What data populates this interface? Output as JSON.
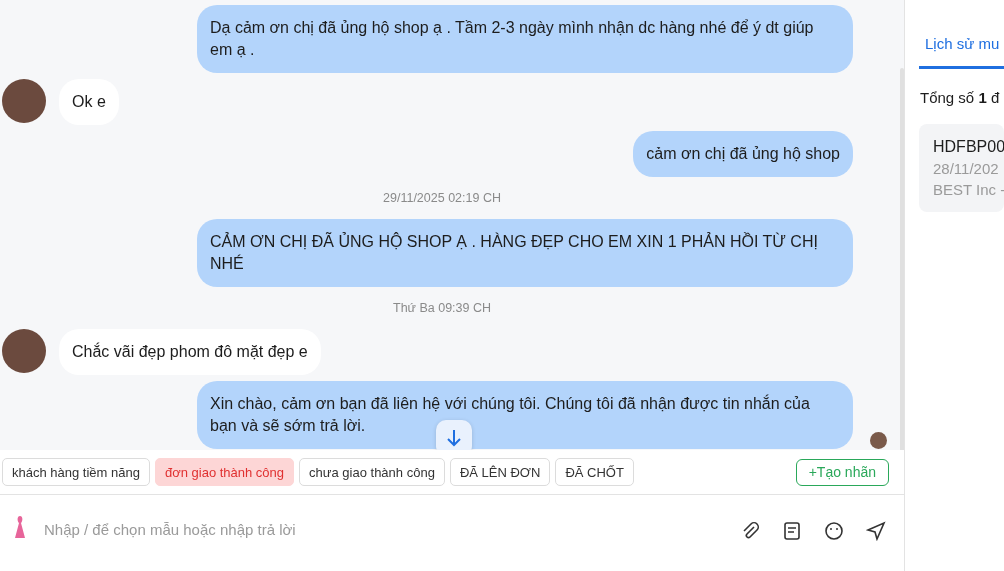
{
  "messages": [
    {
      "kind": "out",
      "text": "Dạ cảm ơn chị đã ủng hộ shop ạ . Tầm 2-3 ngày mình nhận dc hàng nhé để ý dt giúp em ạ ."
    },
    {
      "kind": "in",
      "text": "Ok e"
    },
    {
      "kind": "out",
      "text": "cảm ơn chị đã ủng hộ shop"
    },
    {
      "kind": "time",
      "text": "29/11/2025 02:19 CH"
    },
    {
      "kind": "out",
      "text": "CẢM ƠN CHỊ ĐÃ ỦNG HỘ SHOP Ạ . HÀNG ĐẸP CHO EM XIN 1 PHẢN HỒI TỪ CHỊ NHÉ"
    },
    {
      "kind": "time",
      "text": "Thứ Ba 09:39 CH"
    },
    {
      "kind": "in",
      "text": "Chắc vãi đẹp phom đô mặt đẹp e"
    },
    {
      "kind": "out",
      "text": "Xin chào, cảm ơn bạn đã liên hệ với chúng tôi. Chúng tôi đã nhận được tin nhắn của bạn và sẽ sớm trả lời.",
      "seen": true
    }
  ],
  "tags": [
    {
      "label": "khách hàng tiềm năng",
      "selected": false
    },
    {
      "label": "đơn giao thành công",
      "selected": true
    },
    {
      "label": "chưa giao thành công",
      "selected": false
    },
    {
      "label": "ĐÃ LÊN ĐƠN",
      "selected": false
    },
    {
      "label": "ĐÃ CHỐT",
      "selected": false
    }
  ],
  "create_tag_button": "+Tạo nhãn",
  "composer": {
    "placeholder": "Nhập / để chọn mẫu hoặc nhập trả lời"
  },
  "side_panel": {
    "tab": "Lịch sử mu",
    "summary": "Tổng số **1** đ",
    "order": {
      "code": "HDFBP00",
      "date": "28/11/202",
      "carrier": "BEST Inc -"
    }
  }
}
